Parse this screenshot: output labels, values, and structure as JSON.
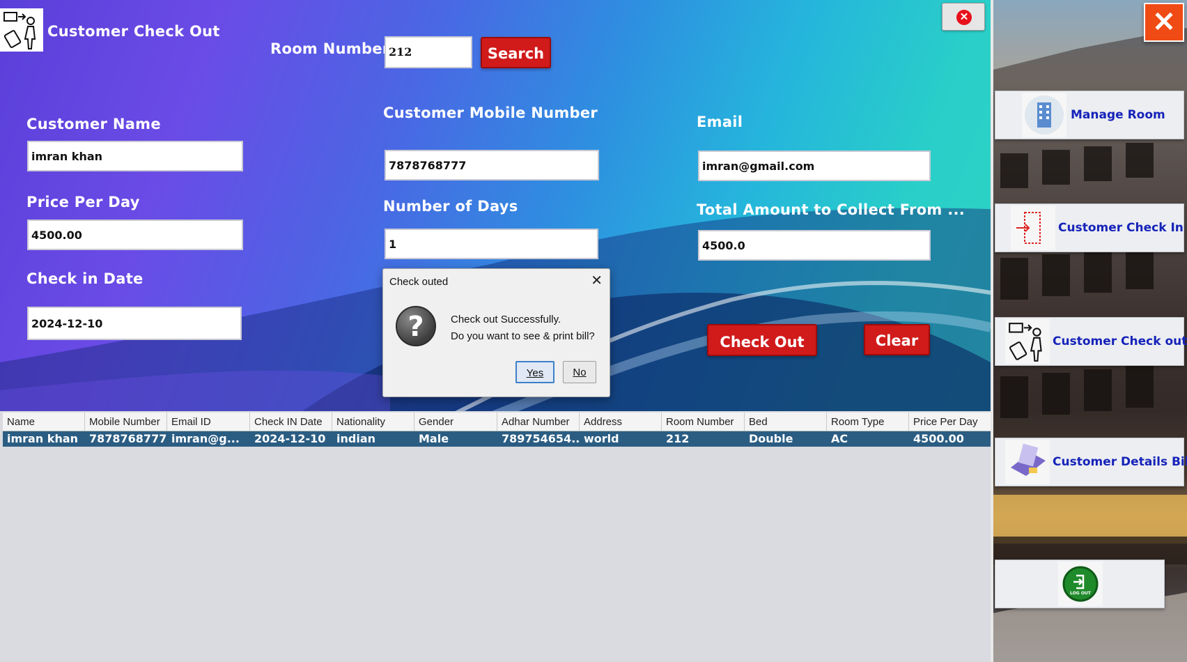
{
  "window": {
    "title": "Customer Check Out"
  },
  "search": {
    "label": "Room Number",
    "value": "212",
    "button": "Search"
  },
  "form": {
    "customer_name": {
      "label": "Customer Name",
      "value": "imran khan"
    },
    "mobile": {
      "label": "Customer Mobile Number",
      "value": "7878768777"
    },
    "email": {
      "label": "Email",
      "value": "imran@gmail.com"
    },
    "price_per_day": {
      "label": "Price Per Day",
      "value": "4500.00"
    },
    "num_days": {
      "label": "Number of Days",
      "value": "1"
    },
    "total_amount": {
      "label": "Total Amount to Collect From ...",
      "value": "4500.0"
    },
    "checkin_date": {
      "label": "Check in Date",
      "value": "2024-12-10"
    }
  },
  "actions": {
    "checkout": "Check Out",
    "clear": "Clear"
  },
  "dialog": {
    "title": "Check outed",
    "message_line1": "Check out Successfully.",
    "message_line2": "Do you want to see & print bill?",
    "yes": "Yes",
    "no": "No"
  },
  "table": {
    "columns": [
      "Name",
      "Mobile Number",
      "Email ID",
      "Check IN Date",
      "Nationality",
      "Gender",
      "Adhar Number",
      "Address",
      "Room Number",
      "Bed",
      "Room Type",
      "Price Per Day"
    ],
    "rows": [
      [
        "imran khan",
        "7878768777",
        "imran@g...",
        "2024-12-10",
        "indian",
        "Male",
        "789754654...",
        "world",
        "212",
        "Double",
        "AC",
        "4500.00"
      ]
    ]
  },
  "sidebar": {
    "items": [
      {
        "label": "Manage Room",
        "icon": "building-icon"
      },
      {
        "label": "Customer Check In",
        "icon": "door-checkin-icon"
      },
      {
        "label": "Customer Check out",
        "icon": "luggage-checkout-icon"
      },
      {
        "label": "Customer Details Bill",
        "icon": "bill-icon"
      },
      {
        "label": "",
        "icon": "logout-icon"
      }
    ],
    "logout_text": "LOG OUT"
  },
  "colors": {
    "accent_red": "#d11a1a",
    "sidebar_text": "#1623b9",
    "table_selected": "#2b5d83",
    "close_orange": "#f04b14"
  }
}
